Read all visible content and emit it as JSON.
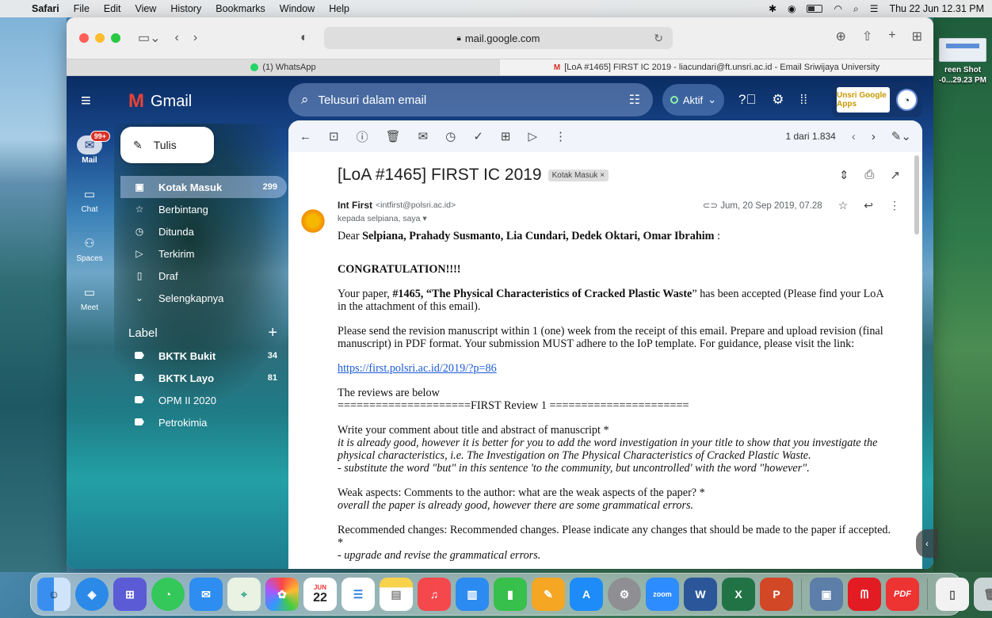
{
  "menubar": {
    "app": "Safari",
    "menus": [
      "File",
      "Edit",
      "View",
      "History",
      "Bookmarks",
      "Window",
      "Help"
    ],
    "clock": "Thu 22 Jun  12.31 PM"
  },
  "desktop": {
    "file_label_line1": "reen Shot",
    "file_label_line2": "-0...29.23 PM"
  },
  "safari": {
    "url": "mail.google.com",
    "tabs": [
      {
        "label": "(1) WhatsApp"
      },
      {
        "label": "[LoA #1465] FIRST IC 2019 - liacundari@ft.unsri.ac.id - Email Sriwijaya University"
      }
    ]
  },
  "gmail": {
    "logo_text": "Gmail",
    "search_placeholder": "Telusuri dalam email",
    "status": "Aktif",
    "account_logo": "Unsri Google Apps",
    "rail": [
      {
        "label": "Mail",
        "badge": "99+"
      },
      {
        "label": "Chat"
      },
      {
        "label": "Spaces"
      },
      {
        "label": "Meet"
      }
    ],
    "compose_label": "Tulis",
    "nav": [
      {
        "label": "Kotak Masuk",
        "count": "299"
      },
      {
        "label": "Berbintang"
      },
      {
        "label": "Ditunda"
      },
      {
        "label": "Terkirim"
      },
      {
        "label": "Draf"
      },
      {
        "label": "Selengkapnya"
      }
    ],
    "labels_heading": "Label",
    "labels": [
      {
        "label": "BKTK Bukit",
        "count": "34"
      },
      {
        "label": "BKTK Layo",
        "count": "81"
      },
      {
        "label": "OPM II 2020"
      },
      {
        "label": "Petrokimia"
      }
    ],
    "pager": "1 dari 1.834"
  },
  "email": {
    "subject": "[LoA #1465] FIRST IC 2019",
    "chip": "Kotak Masuk",
    "sender_name": "Int First",
    "sender_addr": "<intfirst@polsri.ac.id>",
    "date": "Jum, 20 Sep 2019, 07.28",
    "recipients": "kepada selpiana, saya",
    "greeting_prefix": "Dear ",
    "greeting_names": "Selpiana, Prahady Susmanto, Lia Cundari, Dedek Oktari, Omar Ibrahim",
    "greeting_suffix": " :",
    "congrats": "CONGRATULATION!!!!",
    "p1_a": "Your paper, ",
    "p1_bold": "#1465, “The Physical Characteristics of Cracked Plastic Waste",
    "p1_b": "”  has been accepted (Please find your LoA in the attachment of this email).",
    "p2": "Please send the revision manuscript within 1 (one) week from the receipt of this email. Prepare and upload revision (final manuscript) in PDF format. Your submission MUST adhere to the IoP template. For guidance, please visit the link:",
    "link": "https://first.polsri.ac.id/2019/?p=86",
    "reviews_intro": "The reviews are below",
    "review_header": "=====================FIRST Review 1 ======================",
    "q1": "Write your comment about title and abstract of manuscript *",
    "a1_line1": "it is already good, however it is better for you to add the word investigation in your title to show that you investigate the physical characteristics, i.e. The Investigation on The Physical Characteristics of Cracked Plastic Waste.",
    "a1_line2": "- substitute the word \"but\" in this sentence  'to the community, but uncontrolled' with the word \"however\".",
    "q2": "Weak aspects: Comments to the author: what are the weak aspects of the paper? *",
    "a2": "overall the paper is already good, however there are some grammatical errors.",
    "q3": "Recommended changes: Recommended changes. Please indicate any changes that should be made to the paper if accepted. *",
    "a3": "- upgrade and revise the grammatical errors."
  },
  "dock": {
    "calendar_month": "JUN",
    "calendar_day": "22",
    "zoom_label": "zoom",
    "pdf_label": "PDF"
  }
}
